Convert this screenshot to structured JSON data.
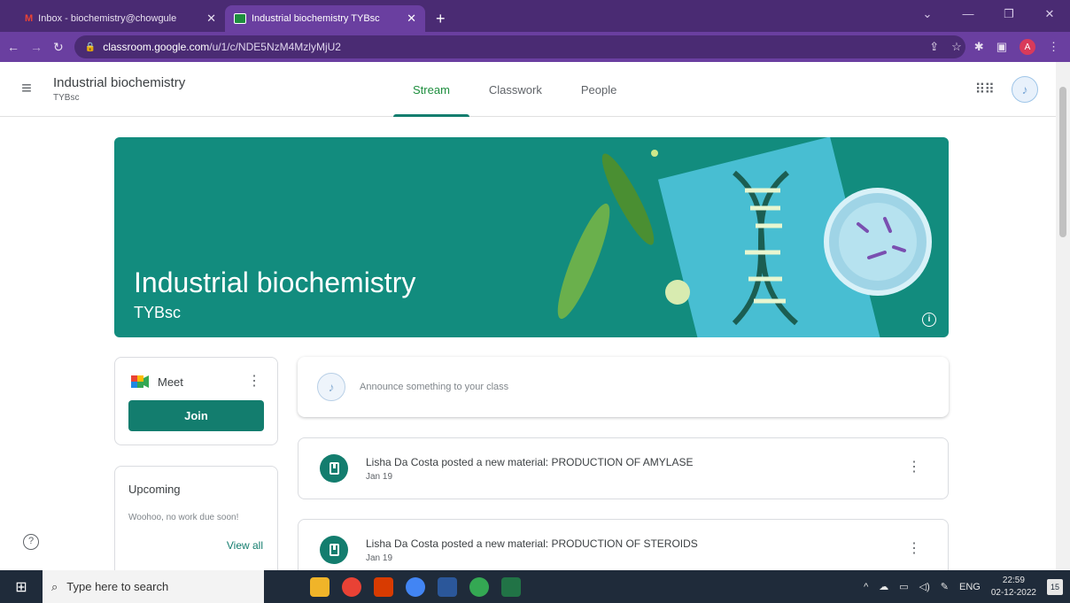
{
  "browser": {
    "tabs": [
      {
        "label": "Inbox - biochemistry@chowgule",
        "close": "✕"
      },
      {
        "label": "Industrial biochemistry TYBsc",
        "close": "✕"
      }
    ],
    "new_tab": "+",
    "url_host": "classroom.google.com",
    "url_path": "/u/1/c/NDE5NzM4MzlyMjU2",
    "profile_initial": "A"
  },
  "header": {
    "class_name": "Industrial biochemistry",
    "class_section": "TYBsc",
    "tabs": [
      "Stream",
      "Classwork",
      "People"
    ],
    "active_tab": "Stream"
  },
  "banner": {
    "title": "Industrial biochemistry",
    "subtitle": "TYBsc",
    "color": "#128c7e"
  },
  "meet": {
    "title": "Meet",
    "join_label": "Join"
  },
  "upcoming": {
    "title": "Upcoming",
    "empty_text": "Woohoo, no work due soon!",
    "view_all": "View all"
  },
  "announce": {
    "placeholder": "Announce something to your class"
  },
  "posts": [
    {
      "title": "Lisha Da Costa posted a new material: PRODUCTION OF AMYLASE",
      "date": "Jan 19"
    },
    {
      "title": "Lisha Da Costa posted a new material: PRODUCTION OF STEROIDS",
      "date": "Jan 19"
    }
  ],
  "taskbar": {
    "search_placeholder": "Type here to search",
    "language": "ENG",
    "time": "22:59",
    "date": "02-12-2022",
    "notifications": "15"
  },
  "colors": {
    "accent": "#137d6e",
    "browser_frame": "#4a2b73"
  }
}
